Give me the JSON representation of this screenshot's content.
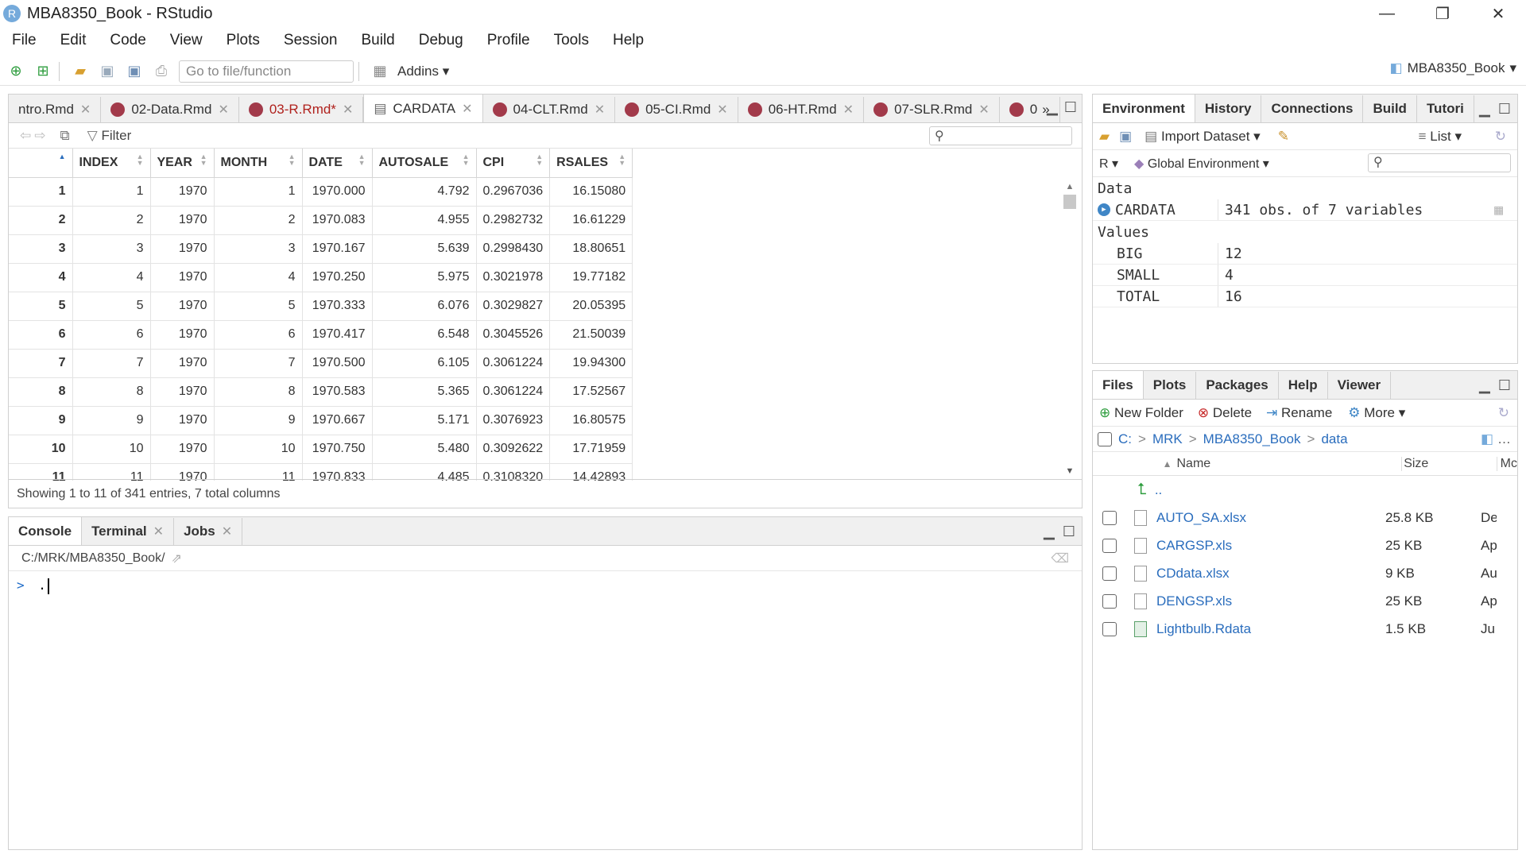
{
  "window": {
    "title": "MBA8350_Book - RStudio",
    "app_icon_letter": "R",
    "controls": [
      "—",
      "❐",
      "✕"
    ]
  },
  "menu": [
    "File",
    "Edit",
    "Code",
    "View",
    "Plots",
    "Session",
    "Build",
    "Debug",
    "Profile",
    "Tools",
    "Help"
  ],
  "toolbar": {
    "goto_placeholder": "Go to file/function",
    "addins_label": "Addins",
    "project_name": "MBA8350_Book"
  },
  "source": {
    "tabs": [
      {
        "label": "ntro.Rmd",
        "icon": "none"
      },
      {
        "label": "02-Data.Rmd",
        "icon": "rmd"
      },
      {
        "label": "03-R.Rmd*",
        "icon": "rmd",
        "modified": true
      },
      {
        "label": "CARDATA",
        "icon": "table",
        "active": true
      },
      {
        "label": "04-CLT.Rmd",
        "icon": "rmd"
      },
      {
        "label": "05-CI.Rmd",
        "icon": "rmd"
      },
      {
        "label": "06-HT.Rmd",
        "icon": "rmd"
      },
      {
        "label": "07-SLR.Rmd",
        "icon": "rmd"
      },
      {
        "label": "0",
        "icon": "rmd"
      }
    ],
    "filter_label": "Filter",
    "columns": [
      "",
      "INDEX",
      "YEAR",
      "MONTH",
      "DATE",
      "AUTOSALE",
      "CPI",
      "RSALES"
    ],
    "rows": [
      [
        "1",
        "1",
        "1970",
        "1",
        "1970.000",
        "4.792",
        "0.2967036",
        "16.15080"
      ],
      [
        "2",
        "2",
        "1970",
        "2",
        "1970.083",
        "4.955",
        "0.2982732",
        "16.61229"
      ],
      [
        "3",
        "3",
        "1970",
        "3",
        "1970.167",
        "5.639",
        "0.2998430",
        "18.80651"
      ],
      [
        "4",
        "4",
        "1970",
        "4",
        "1970.250",
        "5.975",
        "0.3021978",
        "19.77182"
      ],
      [
        "5",
        "5",
        "1970",
        "5",
        "1970.333",
        "6.076",
        "0.3029827",
        "20.05395"
      ],
      [
        "6",
        "6",
        "1970",
        "6",
        "1970.417",
        "6.548",
        "0.3045526",
        "21.50039"
      ],
      [
        "7",
        "7",
        "1970",
        "7",
        "1970.500",
        "6.105",
        "0.3061224",
        "19.94300"
      ],
      [
        "8",
        "8",
        "1970",
        "8",
        "1970.583",
        "5.365",
        "0.3061224",
        "17.52567"
      ],
      [
        "9",
        "9",
        "1970",
        "9",
        "1970.667",
        "5.171",
        "0.3076923",
        "16.80575"
      ],
      [
        "10",
        "10",
        "1970",
        "10",
        "1970.750",
        "5.480",
        "0.3092622",
        "17.71959"
      ],
      [
        "11",
        "11",
        "1970",
        "11",
        "1970.833",
        "4.485",
        "0.3108320",
        "14.42893"
      ]
    ],
    "status": "Showing 1 to 11 of 341 entries, 7 total columns"
  },
  "console": {
    "tabs": [
      "Console",
      "Terminal",
      "Jobs"
    ],
    "path": "C:/MRK/MBA8350_Book/",
    "prompt": ">",
    "input": "."
  },
  "environment": {
    "tabs": [
      "Environment",
      "History",
      "Connections",
      "Build",
      "Tutori"
    ],
    "import_label": "Import Dataset",
    "list_label": "List",
    "lang_label": "R",
    "scope_label": "Global Environment",
    "data_header": "Data",
    "data_items": [
      {
        "name": "CARDATA",
        "value": "341 obs. of 7 variables"
      }
    ],
    "values_header": "Values",
    "value_items": [
      {
        "name": "BIG",
        "value": "12"
      },
      {
        "name": "SMALL",
        "value": "4"
      },
      {
        "name": "TOTAL",
        "value": "16"
      }
    ]
  },
  "files": {
    "tabs": [
      "Files",
      "Plots",
      "Packages",
      "Help",
      "Viewer"
    ],
    "new_folder": "New Folder",
    "delete": "Delete",
    "rename": "Rename",
    "more": "More",
    "path": [
      "C:",
      "MRK",
      "MBA8350_Book",
      "data"
    ],
    "path_sep": ">",
    "header_name": "Name",
    "header_size": "Size",
    "header_mod": "Mc",
    "up_label": "..",
    "items": [
      {
        "name": "AUTO_SA.xlsx",
        "size": "25.8 KB",
        "mod": "De"
      },
      {
        "name": "CARGSP.xls",
        "size": "25 KB",
        "mod": "Ap"
      },
      {
        "name": "CDdata.xlsx",
        "size": "9 KB",
        "mod": "Au"
      },
      {
        "name": "DENGSP.xls",
        "size": "25 KB",
        "mod": "Ap"
      },
      {
        "name": "Lightbulb.Rdata",
        "size": "1.5 KB",
        "mod": "Ju"
      }
    ]
  },
  "colors": {
    "accent": "#75aadb",
    "link": "#2a6dbd",
    "modified_tab": "#b0211d",
    "rmd_icon": "#a23a4a"
  }
}
